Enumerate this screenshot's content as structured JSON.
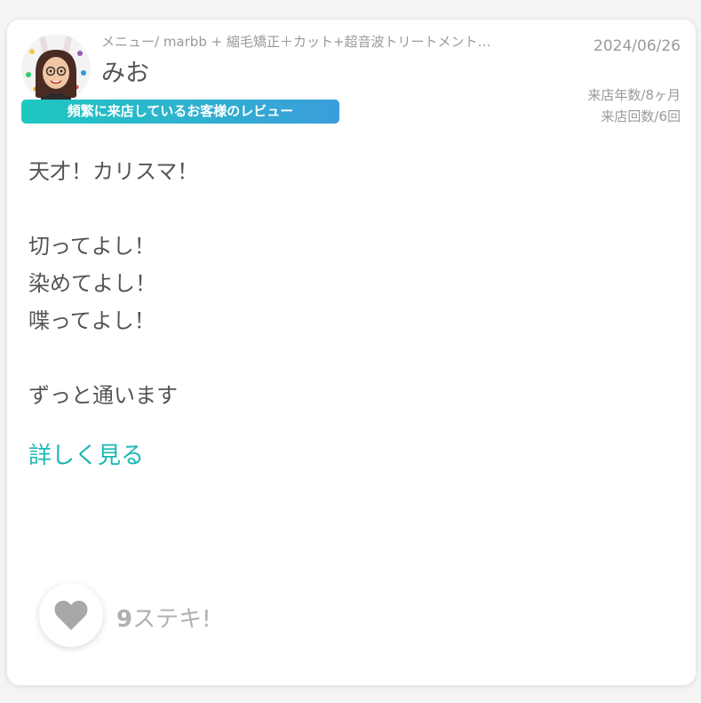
{
  "review": {
    "menu": "メニュー/ marbb + 縮毛矯正＋カット+超音波トリートメント…",
    "user_name": "みお",
    "date": "2024/06/26",
    "visit_duration": "来店年数/8ヶ月",
    "visit_count": "来店回数/6回",
    "badge": "頻繁に来店しているお客様のレビュー",
    "body_lines": [
      "天才！カリスマ！",
      "",
      "切ってよし！",
      "染めてよし！",
      "喋ってよし！",
      "",
      "ずっと通います"
    ],
    "read_more": "詳しく見る",
    "like_count": "9",
    "like_label": "ステキ!"
  },
  "colors": {
    "accent": "#1bb8b3",
    "badge_gradient_start": "#1ec8c0",
    "badge_gradient_end": "#3b9ddb",
    "muted_text": "#9a9a9a",
    "body_text": "#555555",
    "heart": "#a8a8a8"
  },
  "icons": {
    "avatar": "user-avatar-illustration",
    "like": "heart-icon"
  }
}
